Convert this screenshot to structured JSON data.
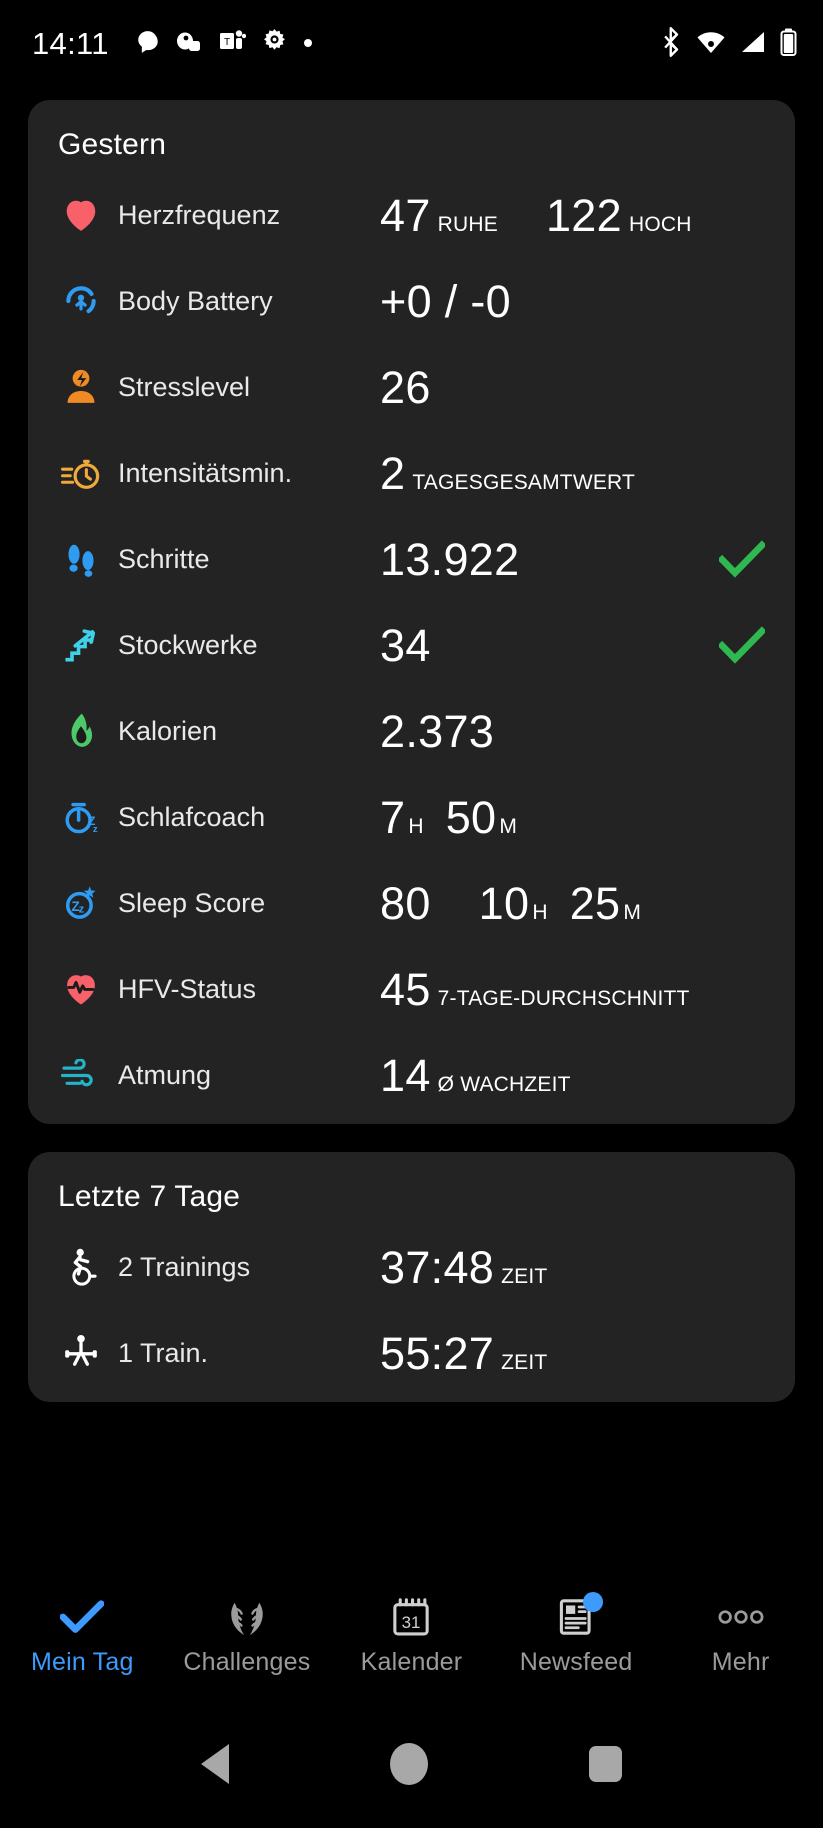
{
  "status_bar": {
    "time": "14:11",
    "left_icons": [
      "chat-bubble-icon",
      "game-controller-icon",
      "teams-icon",
      "settings-gear-icon",
      "dot-icon"
    ],
    "right_icons": [
      "bluetooth-icon",
      "wifi-icon",
      "cellular-signal-icon",
      "battery-icon"
    ]
  },
  "cards": [
    {
      "title": "Gestern",
      "rows": [
        {
          "icon": "heart-icon",
          "label": "Herzfrequenz",
          "metrics": [
            {
              "value": "47",
              "unit": "RUHE"
            },
            {
              "value": "122",
              "unit": "HOCH"
            }
          ],
          "check": false
        },
        {
          "icon": "body-battery-icon",
          "label": "Body Battery",
          "metrics": [
            {
              "value": "+0 / -0",
              "unit": ""
            }
          ],
          "check": false
        },
        {
          "icon": "stress-icon",
          "label": "Stresslevel",
          "metrics": [
            {
              "value": "26",
              "unit": ""
            }
          ],
          "check": false
        },
        {
          "icon": "stopwatch-icon",
          "label": "Intensitätsmin.",
          "metrics": [
            {
              "value": "2",
              "unit": "TAGESGESAMTWERT"
            }
          ],
          "check": false
        },
        {
          "icon": "footsteps-icon",
          "label": "Schritte",
          "metrics": [
            {
              "value": "13.922",
              "unit": ""
            }
          ],
          "check": true
        },
        {
          "icon": "stairs-icon",
          "label": "Stockwerke",
          "metrics": [
            {
              "value": "34",
              "unit": ""
            }
          ],
          "check": true
        },
        {
          "icon": "flame-icon",
          "label": "Kalorien",
          "metrics": [
            {
              "value": "2.373",
              "unit": ""
            }
          ],
          "check": false
        },
        {
          "icon": "sleep-clock-icon",
          "label": "Schlafcoach",
          "metrics": [
            {
              "value": "7",
              "unit": "H"
            },
            {
              "value": "50",
              "unit": "M"
            }
          ],
          "check": false
        },
        {
          "icon": "sleep-star-icon",
          "label": "Sleep Score",
          "metrics": [
            {
              "value": "80",
              "unit": ""
            },
            {
              "value": "10",
              "unit": "H"
            },
            {
              "value": "25",
              "unit": "M"
            }
          ],
          "check": false
        },
        {
          "icon": "heart-pulse-icon",
          "label": "HFV-Status",
          "metrics": [
            {
              "value": "45",
              "unit": "7-TAGE-DURCHSCHNITT"
            }
          ],
          "check": false
        },
        {
          "icon": "breath-wind-icon",
          "label": "Atmung",
          "metrics": [
            {
              "value": "14",
              "unit": "Ø WACHZEIT"
            }
          ],
          "check": false
        }
      ]
    },
    {
      "title": "Letzte 7 Tage",
      "rows": [
        {
          "icon": "cycling-icon",
          "label": "2 Trainings",
          "metrics": [
            {
              "value": "37:48",
              "unit": "ZEIT"
            }
          ],
          "check": false
        },
        {
          "icon": "strength-icon",
          "label": "1 Train.",
          "metrics": [
            {
              "value": "55:27",
              "unit": "ZEIT"
            }
          ],
          "check": false
        }
      ]
    }
  ],
  "tabbar": {
    "items": [
      {
        "label": "Mein Tag",
        "icon": "checkmark-icon",
        "active": true,
        "badge": false
      },
      {
        "label": "Challenges",
        "icon": "laurel-icon",
        "active": false,
        "badge": false
      },
      {
        "label": "Kalender",
        "icon": "calendar-31-icon",
        "active": false,
        "badge": false
      },
      {
        "label": "Newsfeed",
        "icon": "newspaper-icon",
        "active": false,
        "badge": true
      },
      {
        "label": "Mehr",
        "icon": "more-dots-icon",
        "active": false,
        "badge": false
      }
    ]
  },
  "android_nav": {
    "back": "back-triangle-icon",
    "home": "home-circle-icon",
    "recents": "recents-square-icon"
  },
  "colors": {
    "background": "#000000",
    "card": "#232323",
    "accent": "#3d9bfd",
    "check_green": "#2eb84f",
    "heart_red": "#f8606a",
    "orange": "#f08a24",
    "blue": "#2f9cf4",
    "cyan": "#3fd1e8",
    "green": "#4ec96a",
    "teal": "#23b5c7",
    "text_primary": "#ffffff",
    "text_secondary": "#9b9b9b"
  }
}
